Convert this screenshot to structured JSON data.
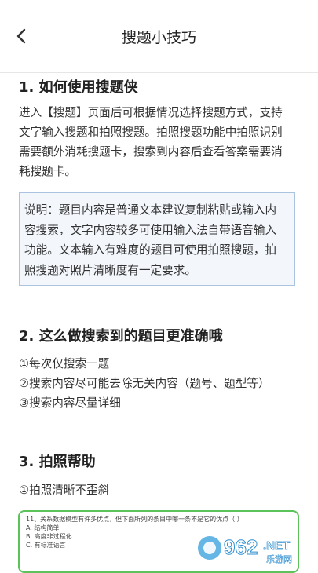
{
  "header": {
    "title": "搜题小技巧"
  },
  "section1": {
    "heading": "1. 如何使用搜题侠",
    "lines": [
      "进入【搜题】页面后可根据情况选择搜题方式，支持",
      "文字输入搜题和拍照搜题。拍照搜题功能中拍照识别",
      "需要额外消耗搜题卡，搜索到内容后查看答案需要消",
      "耗搜题卡。"
    ],
    "note_lines": [
      "说明：题目内容是普通文本建议复制粘贴或输入内",
      "容搜索，文字内容较多可使用输入法自带语音输入",
      "功能。文本输入有难度的题目可使用拍照搜题，拍",
      "照搜题对照片清晰度有一定要求。"
    ]
  },
  "section2": {
    "heading": "2. 这么做搜索到的题目更准确哦",
    "items": [
      "①每次仅搜索一题",
      "②搜索内容尽可能去除无关内容（题号、题型等）",
      "③搜索内容尽量详细"
    ]
  },
  "section3": {
    "heading": "3. 拍照帮助",
    "items": [
      "①拍照清晰不歪斜"
    ],
    "sample": {
      "question": "11、关系数据模型有许多优点，但下面所列的条目中哪一条不是它的优点（        ）",
      "options": [
        "A. 结构简单",
        "B. 高度非过程化",
        "C. 有标准语言"
      ]
    }
  },
  "watermark": {
    "text1": "962",
    "text2": ".NET",
    "text3": "乐游网"
  },
  "colors": {
    "accent_green": "#5cc35a",
    "note_border": "#a9c3e0",
    "note_bg": "#f3f7fc"
  }
}
